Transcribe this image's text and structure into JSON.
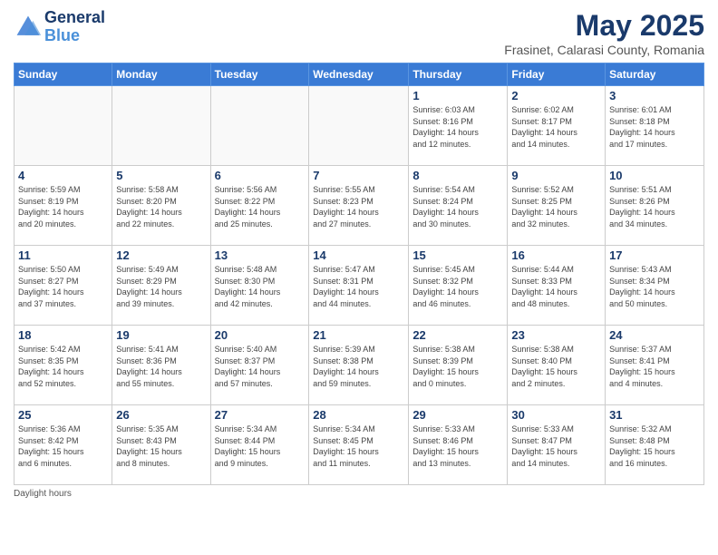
{
  "header": {
    "logo_line1": "General",
    "logo_line2": "Blue",
    "month_title": "May 2025",
    "location": "Frasinet, Calarasi County, Romania"
  },
  "days_of_week": [
    "Sunday",
    "Monday",
    "Tuesday",
    "Wednesday",
    "Thursday",
    "Friday",
    "Saturday"
  ],
  "weeks": [
    [
      {
        "day": "",
        "info": ""
      },
      {
        "day": "",
        "info": ""
      },
      {
        "day": "",
        "info": ""
      },
      {
        "day": "",
        "info": ""
      },
      {
        "day": "1",
        "info": "Sunrise: 6:03 AM\nSunset: 8:16 PM\nDaylight: 14 hours\nand 12 minutes."
      },
      {
        "day": "2",
        "info": "Sunrise: 6:02 AM\nSunset: 8:17 PM\nDaylight: 14 hours\nand 14 minutes."
      },
      {
        "day": "3",
        "info": "Sunrise: 6:01 AM\nSunset: 8:18 PM\nDaylight: 14 hours\nand 17 minutes."
      }
    ],
    [
      {
        "day": "4",
        "info": "Sunrise: 5:59 AM\nSunset: 8:19 PM\nDaylight: 14 hours\nand 20 minutes."
      },
      {
        "day": "5",
        "info": "Sunrise: 5:58 AM\nSunset: 8:20 PM\nDaylight: 14 hours\nand 22 minutes."
      },
      {
        "day": "6",
        "info": "Sunrise: 5:56 AM\nSunset: 8:22 PM\nDaylight: 14 hours\nand 25 minutes."
      },
      {
        "day": "7",
        "info": "Sunrise: 5:55 AM\nSunset: 8:23 PM\nDaylight: 14 hours\nand 27 minutes."
      },
      {
        "day": "8",
        "info": "Sunrise: 5:54 AM\nSunset: 8:24 PM\nDaylight: 14 hours\nand 30 minutes."
      },
      {
        "day": "9",
        "info": "Sunrise: 5:52 AM\nSunset: 8:25 PM\nDaylight: 14 hours\nand 32 minutes."
      },
      {
        "day": "10",
        "info": "Sunrise: 5:51 AM\nSunset: 8:26 PM\nDaylight: 14 hours\nand 34 minutes."
      }
    ],
    [
      {
        "day": "11",
        "info": "Sunrise: 5:50 AM\nSunset: 8:27 PM\nDaylight: 14 hours\nand 37 minutes."
      },
      {
        "day": "12",
        "info": "Sunrise: 5:49 AM\nSunset: 8:29 PM\nDaylight: 14 hours\nand 39 minutes."
      },
      {
        "day": "13",
        "info": "Sunrise: 5:48 AM\nSunset: 8:30 PM\nDaylight: 14 hours\nand 42 minutes."
      },
      {
        "day": "14",
        "info": "Sunrise: 5:47 AM\nSunset: 8:31 PM\nDaylight: 14 hours\nand 44 minutes."
      },
      {
        "day": "15",
        "info": "Sunrise: 5:45 AM\nSunset: 8:32 PM\nDaylight: 14 hours\nand 46 minutes."
      },
      {
        "day": "16",
        "info": "Sunrise: 5:44 AM\nSunset: 8:33 PM\nDaylight: 14 hours\nand 48 minutes."
      },
      {
        "day": "17",
        "info": "Sunrise: 5:43 AM\nSunset: 8:34 PM\nDaylight: 14 hours\nand 50 minutes."
      }
    ],
    [
      {
        "day": "18",
        "info": "Sunrise: 5:42 AM\nSunset: 8:35 PM\nDaylight: 14 hours\nand 52 minutes."
      },
      {
        "day": "19",
        "info": "Sunrise: 5:41 AM\nSunset: 8:36 PM\nDaylight: 14 hours\nand 55 minutes."
      },
      {
        "day": "20",
        "info": "Sunrise: 5:40 AM\nSunset: 8:37 PM\nDaylight: 14 hours\nand 57 minutes."
      },
      {
        "day": "21",
        "info": "Sunrise: 5:39 AM\nSunset: 8:38 PM\nDaylight: 14 hours\nand 59 minutes."
      },
      {
        "day": "22",
        "info": "Sunrise: 5:38 AM\nSunset: 8:39 PM\nDaylight: 15 hours\nand 0 minutes."
      },
      {
        "day": "23",
        "info": "Sunrise: 5:38 AM\nSunset: 8:40 PM\nDaylight: 15 hours\nand 2 minutes."
      },
      {
        "day": "24",
        "info": "Sunrise: 5:37 AM\nSunset: 8:41 PM\nDaylight: 15 hours\nand 4 minutes."
      }
    ],
    [
      {
        "day": "25",
        "info": "Sunrise: 5:36 AM\nSunset: 8:42 PM\nDaylight: 15 hours\nand 6 minutes."
      },
      {
        "day": "26",
        "info": "Sunrise: 5:35 AM\nSunset: 8:43 PM\nDaylight: 15 hours\nand 8 minutes."
      },
      {
        "day": "27",
        "info": "Sunrise: 5:34 AM\nSunset: 8:44 PM\nDaylight: 15 hours\nand 9 minutes."
      },
      {
        "day": "28",
        "info": "Sunrise: 5:34 AM\nSunset: 8:45 PM\nDaylight: 15 hours\nand 11 minutes."
      },
      {
        "day": "29",
        "info": "Sunrise: 5:33 AM\nSunset: 8:46 PM\nDaylight: 15 hours\nand 13 minutes."
      },
      {
        "day": "30",
        "info": "Sunrise: 5:33 AM\nSunset: 8:47 PM\nDaylight: 15 hours\nand 14 minutes."
      },
      {
        "day": "31",
        "info": "Sunrise: 5:32 AM\nSunset: 8:48 PM\nDaylight: 15 hours\nand 16 minutes."
      }
    ]
  ],
  "footer": "Daylight hours"
}
